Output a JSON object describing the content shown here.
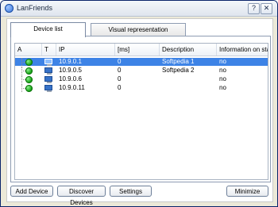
{
  "window": {
    "title": "LanFriends",
    "help_glyph": "?",
    "close_glyph": "✕"
  },
  "tabs": [
    {
      "label": "Device list",
      "active": true
    },
    {
      "label": "Visual representation",
      "active": false
    }
  ],
  "grid": {
    "columns": [
      "A",
      "T",
      "IP",
      "[ms]",
      "Description",
      "Information on state c"
    ],
    "rows": [
      {
        "ip": "10.9.0.1",
        "ms": "0",
        "description": "Softpedia 1",
        "info": "no",
        "selected": true
      },
      {
        "ip": "10.9.0.5",
        "ms": "0",
        "description": "Softpedia 2",
        "info": "no",
        "selected": false
      },
      {
        "ip": "10.9.0.6",
        "ms": "0",
        "description": "",
        "info": "no",
        "selected": false
      },
      {
        "ip": "10.9.0.11",
        "ms": "0",
        "description": "",
        "info": "no",
        "selected": false
      }
    ]
  },
  "buttons": {
    "add_device": "Add Device",
    "discover_devices": "Discover Devices",
    "settings": "Settings",
    "minimize": "Minimize"
  },
  "colors": {
    "selection": "#3d83e6",
    "status_online": "#14a114"
  }
}
